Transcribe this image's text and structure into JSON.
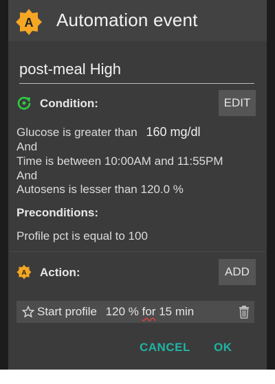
{
  "header": {
    "app_icon_letter": "A",
    "title": "Automation event"
  },
  "event": {
    "name": "post-meal High"
  },
  "condition": {
    "label": "Condition:",
    "edit_label": "EDIT",
    "lines": [
      "Glucose is greater than",
      "And",
      "Time is between 10:00AM and 11:55PM",
      "And",
      "Autosens is lesser than 120.0 %"
    ],
    "glucose_value": "160 mg/dl"
  },
  "preconditions": {
    "label": "Preconditions:",
    "lines": [
      "Profile pct is equal to 100"
    ]
  },
  "action": {
    "label": "Action:",
    "add_label": "ADD",
    "item_name": "Start profile",
    "item_value_pct": "120 %",
    "item_value_for": "for",
    "item_value_duration": "15 min",
    "icon_letter": "A"
  },
  "buttons": {
    "cancel": "CANCEL",
    "ok": "OK"
  },
  "colors": {
    "accent_teal": "#1fb5a4",
    "badge_orange": "#f5a623",
    "condition_green": "#2ecc40"
  }
}
